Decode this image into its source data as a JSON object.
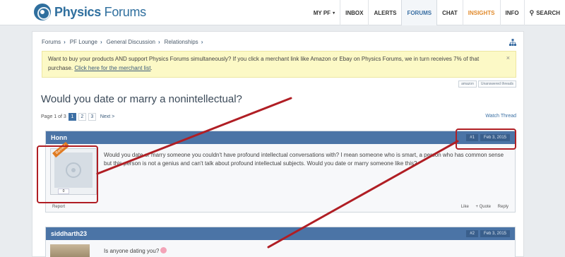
{
  "header": {
    "logo_text_a": "Physics",
    "logo_text_b": "Forums",
    "nav": [
      {
        "label": "MY PF",
        "caret": true
      },
      {
        "label": "INBOX"
      },
      {
        "label": "ALERTS"
      },
      {
        "label": "FORUMS",
        "active": true
      },
      {
        "label": "CHAT"
      },
      {
        "label": "INSIGHTS",
        "accent": "#e18a2c"
      },
      {
        "label": "INFO"
      },
      {
        "label": "SEARCH",
        "icon": "search-icon"
      }
    ]
  },
  "breadcrumb": [
    "Forums",
    "PF Lounge",
    "General Discussion",
    "Relationships"
  ],
  "notice": {
    "text": "Want to buy your products AND support Physics Forums simultaneously? If you click a merchant link like Amazon or Ebay on Physics Forums, we in turn receives 7% of that purchase.",
    "link": "Click here for the merchant list",
    "link_suffix": ".",
    "close": "×"
  },
  "ads": [
    "amazon",
    "Unanswered threads"
  ],
  "thread": {
    "title": "Would you date or marry a nonintellectual?",
    "page_label": "Page 1 of 3",
    "pages": [
      "1",
      "2",
      "3"
    ],
    "next": "Next >",
    "watch": "Watch Thread"
  },
  "posts": [
    {
      "user": "Honn",
      "number": "#1",
      "date": "Feb 3, 2015",
      "ribbon": "Banned",
      "count": "0",
      "body": "Would you date or marry someone you couldn't have profound intellectual conversations with? I mean someone who is smart, a person who has common sense but this person is not a genius and can't talk about profound intellectual subjects. Would you date or marry someone like this?",
      "report": "Report",
      "like": "Like",
      "quote": "+ Quote",
      "reply": "Reply"
    },
    {
      "user": "siddharth23",
      "number": "#2",
      "date": "Feb 3, 2015",
      "body": "Is anyone dating you?"
    }
  ],
  "colors": {
    "accent": "#4b74a6",
    "annotation": "#b01e24",
    "notice_bg": "#fcf9c6"
  }
}
